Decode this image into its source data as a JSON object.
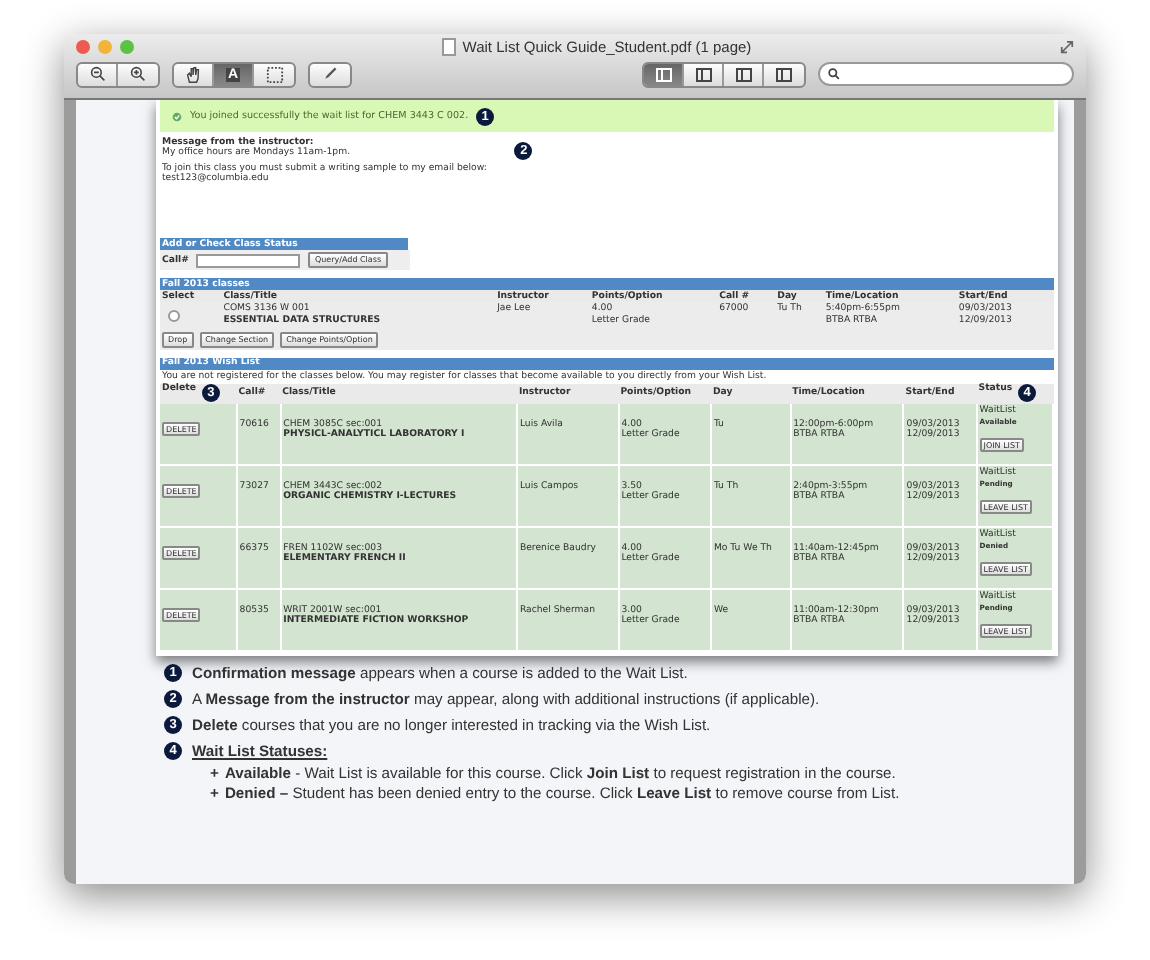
{
  "window": {
    "title": "Wait List Quick Guide_Student.pdf (1 page)"
  },
  "tools": [
    {
      "kind": "hand",
      "selected": false
    },
    {
      "kind": "text",
      "label": "A",
      "selected": true
    },
    {
      "kind": "select",
      "selected": false
    }
  ],
  "view_modes": [
    {
      "selected": true
    },
    {
      "selected": false
    },
    {
      "selected": false
    },
    {
      "selected": false
    }
  ],
  "confirmation": {
    "text": "You joined successfully the wait list for CHEM 3443 C 002.",
    "badge": "1"
  },
  "instructor_message": {
    "title": "Message from the instructor:",
    "paragraphs": [
      [
        "My office hours are Mondays 11am-1pm."
      ],
      [
        "To join this class you must submit a writing sample to my email below:",
        "test123@columbia.edu"
      ]
    ],
    "badge": "2"
  },
  "add_class": {
    "title": "Add or Check Class Status",
    "call_label": "Call#",
    "button": "Query/Add Class"
  },
  "classes": {
    "title": "Fall 2013 classes",
    "columns": [
      {
        "label": "Select"
      },
      {
        "label": "Class/Title"
      },
      {
        "label": "Instructor"
      },
      {
        "label": "Points/Option"
      },
      {
        "label": "Call #"
      },
      {
        "label": "Day"
      },
      {
        "label": "Time/Location"
      },
      {
        "label": "Start/End"
      }
    ],
    "rows": [
      {
        "selected": false,
        "course": "COMS 3136 W 001",
        "title": "ESSENTIAL DATA STRUCTURES",
        "instructor": "Jae Lee",
        "points": "4.00",
        "option": "Letter Grade",
        "call": "67000",
        "day": "Tu Th",
        "time": "5:40pm-6:55pm",
        "location": "BTBA RTBA",
        "start": "09/03/2013",
        "end": "12/09/2013"
      }
    ],
    "buttons": [
      "Drop",
      "Change Section",
      "Change Points/Option"
    ]
  },
  "wish_list": {
    "title": "Fall 2013 Wish List",
    "note": "You are not registered for the classes below. You may register for classes that become available to you directly from your Wish List.",
    "columns": [
      {
        "label": "Delete",
        "badge": "3"
      },
      {
        "label": "Call#"
      },
      {
        "label": "Class/Title"
      },
      {
        "label": "Instructor"
      },
      {
        "label": "Points/Option"
      },
      {
        "label": "Day"
      },
      {
        "label": "Time/Location"
      },
      {
        "label": "Start/End"
      },
      {
        "label": "Status",
        "badge": "4"
      }
    ],
    "rows": [
      {
        "delete": "DELETE",
        "call": "70616",
        "course": "CHEM 3085C sec:001",
        "title": "PHYSICL-ANALYTICL LABORATORY I",
        "instructor": "Luis Avila",
        "points": "4.00",
        "option": "Letter Grade",
        "day": "Tu",
        "time": "12:00pm-6:00pm",
        "location": "BTBA RTBA",
        "start": "09/03/2013",
        "end": "12/09/2013",
        "status": "WaitList",
        "status_detail": "Available",
        "action": "JOIN LIST"
      },
      {
        "delete": "DELETE",
        "call": "73027",
        "course": "CHEM 3443C sec:002",
        "title": "ORGANIC CHEMISTRY I-LECTURES",
        "instructor": "Luis Campos",
        "points": "3.50",
        "option": "Letter Grade",
        "day": "Tu Th",
        "time": "2:40pm-3:55pm",
        "location": "BTBA RTBA",
        "start": "09/03/2013",
        "end": "12/09/2013",
        "status": "WaitList",
        "status_detail": "Pending",
        "action": "LEAVE LIST"
      },
      {
        "delete": "DELETE",
        "call": "66375",
        "course": "FREN 1102W sec:003",
        "title": "ELEMENTARY FRENCH II",
        "instructor": "Berenice Baudry",
        "points": "4.00",
        "option": "Letter Grade",
        "day": "Mo Tu We Th",
        "time": "11:40am-12:45pm",
        "location": "BTBA RTBA",
        "start": "09/03/2013",
        "end": "12/09/2013",
        "status": "WaitList",
        "status_detail": "Denied",
        "action": "LEAVE LIST"
      },
      {
        "delete": "DELETE",
        "call": "80535",
        "course": "WRIT 2001W sec:001",
        "title": "INTERMEDIATE FICTION WORKSHOP",
        "instructor": "Rachel Sherman",
        "points": "3.00",
        "option": "Letter Grade",
        "day": "We",
        "time": "11:00am-12:30pm",
        "location": "BTBA RTBA",
        "start": "09/03/2013",
        "end": "12/09/2013",
        "status": "WaitList",
        "status_detail": "Pending",
        "action": "LEAVE LIST"
      }
    ]
  },
  "notes": [
    {
      "badge": "1",
      "text": "**Confirmation message** appears when a course is added to the Wait List."
    },
    {
      "badge": "2",
      "text": "A **Message from the instructor** may appear, along with additional instructions (if applicable)."
    },
    {
      "badge": "3",
      "text": "**Delete** courses that you are no longer interested in tracking via the Wish List."
    },
    {
      "badge": "4",
      "title": "Wait List Statuses:",
      "children": [
        {
          "bullet": "+",
          "text": "**Available** - Wait List is available for this course. Click **Join List** to request registration in the course."
        },
        {
          "bullet": "+",
          "text": "**Denied –** Student has been denied entry to the course. Click **Leave List** to remove course from List."
        }
      ]
    }
  ]
}
